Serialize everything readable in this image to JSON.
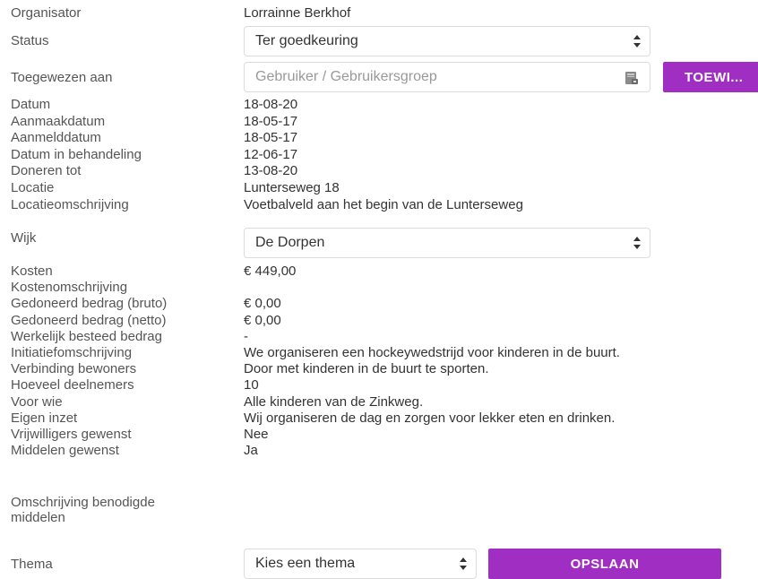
{
  "organisator": {
    "label": "Organisator",
    "value": "Lorrainne Berkhof"
  },
  "status": {
    "label": "Status",
    "selected": "Ter goedkeuring"
  },
  "toegewezen": {
    "label": "Toegewezen aan",
    "placeholder": "Gebruiker / Gebruikersgroep",
    "button": "TOEWI..."
  },
  "fields": [
    {
      "label": "Datum",
      "value": "18-08-20"
    },
    {
      "label": "Aanmaakdatum",
      "value": "18-05-17"
    },
    {
      "label": "Aanmelddatum",
      "value": "18-05-17"
    },
    {
      "label": "Datum in behandeling",
      "value": "12-06-17"
    },
    {
      "label": "Doneren tot",
      "value": "13-08-20"
    },
    {
      "label": "Locatie",
      "value": "Lunterseweg 18"
    },
    {
      "label": "Locatieomschrijving",
      "value": "Voetbalveld aan het begin van de Lunterseweg"
    }
  ],
  "wijk": {
    "label": "Wijk",
    "selected": "De Dorpen"
  },
  "fields2": [
    {
      "label": "Kosten",
      "value": "€ 449,00"
    },
    {
      "label": "Kostenomschrijving",
      "value": ""
    },
    {
      "label": "Gedoneerd bedrag (bruto)",
      "value": "€ 0,00"
    },
    {
      "label": "Gedoneerd bedrag (netto)",
      "value": "€ 0,00"
    },
    {
      "label": "Werkelijk besteed bedrag",
      "value": "-"
    },
    {
      "label": "Initiatiefomschrijving",
      "value": "We organiseren een hockeywedstrijd voor kinderen in de buurt."
    },
    {
      "label": "Verbinding bewoners",
      "value": "Door met kinderen in de buurt te sporten."
    },
    {
      "label": "Hoeveel deelnemers",
      "value": "10"
    },
    {
      "label": "Voor wie",
      "value": "Alle kinderen van de Zinkweg."
    },
    {
      "label": "Eigen inzet",
      "value": "Wij organiseren de dag en zorgen voor lekker eten en drinken."
    },
    {
      "label": "Vrijwilligers gewenst",
      "value": "Nee"
    },
    {
      "label": "Middelen gewenst",
      "value": "Ja"
    }
  ],
  "benodigde": {
    "label_line1": "Omschrijving benodigde",
    "label_line2": "middelen"
  },
  "thema": {
    "label": "Thema",
    "selected": "Kies een thema",
    "save_button": "OPSLAAN"
  },
  "colors": {
    "accent": "#a12ec2"
  },
  "icons": {
    "address_book": "address-book-icon",
    "select_arrows": "select-arrows-icon"
  }
}
